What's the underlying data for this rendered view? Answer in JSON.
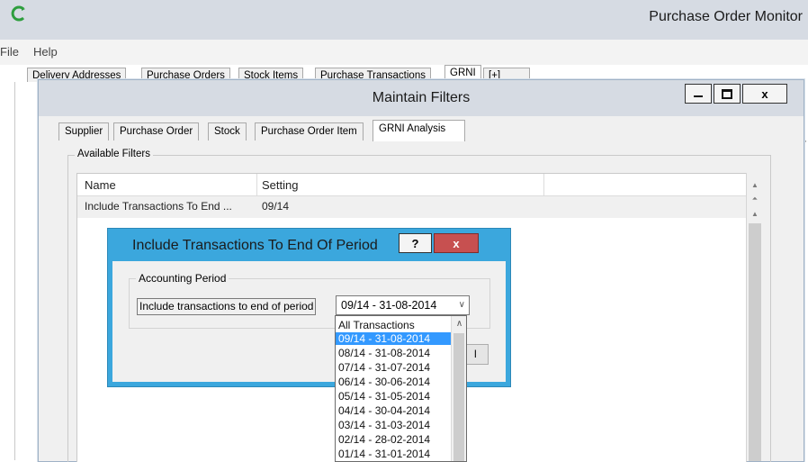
{
  "app": {
    "title": "Purchase Order Monitor",
    "menu": [
      "File",
      "Help"
    ],
    "tabs": [
      "Delivery Addresses",
      "Purchase Orders",
      "Stock Items",
      "Purchase Transactions",
      "GRNI",
      "[+]"
    ],
    "active_tab": "GRNI",
    "partial_text": "r"
  },
  "maintain_filters": {
    "title": "Maintain Filters",
    "minimize_icon": "minimize-icon",
    "maximize_icon": "maximize-icon",
    "close_label": "x",
    "tabs": [
      "Supplier",
      "Purchase Order",
      "Stock",
      "Purchase Order Item",
      "GRNI Analysis"
    ],
    "active_tab": "GRNI Analysis",
    "group_label": "Available Filters",
    "grid": {
      "columns": [
        "Name",
        "Setting"
      ],
      "rows": [
        {
          "name": "Include Transactions To End ...",
          "setting": "09/14"
        }
      ]
    }
  },
  "include_dialog": {
    "title": "Include Transactions To End Of Period",
    "help_label": "?",
    "close_label": "x",
    "group_label": "Accounting Period",
    "field_label": "Include transactions to end of period",
    "combo_value": "09/14 - 31-08-2014",
    "button_partial": "l",
    "options": [
      "All Transactions",
      "09/14 - 31-08-2014",
      "08/14 - 31-08-2014",
      "07/14 - 31-07-2014",
      "06/14 - 30-06-2014",
      "05/14 - 31-05-2014",
      "04/14 - 30-04-2014",
      "03/14 - 31-03-2014",
      "02/14 - 28-02-2014",
      "01/14 - 31-01-2014"
    ],
    "selected_option": "09/14 - 31-08-2014"
  },
  "colors": {
    "titlebar": "#d6dbe3",
    "dialog_accent": "#3ba7dd",
    "close_red": "#c75050",
    "selection": "#3399ff",
    "logo_green": "#2e9e3e"
  }
}
